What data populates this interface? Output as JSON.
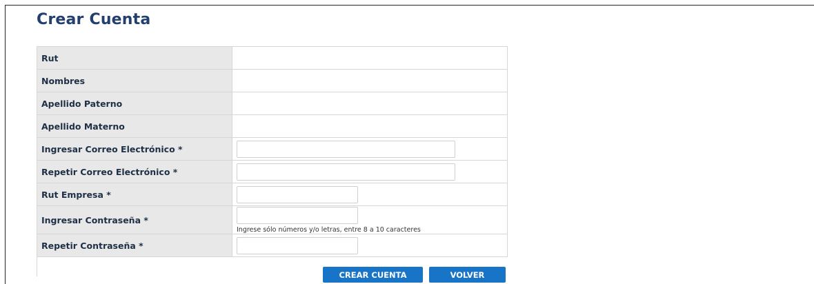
{
  "page": {
    "title": "Crear Cuenta"
  },
  "form": {
    "rows": [
      {
        "label": "Rut",
        "type": "static",
        "value": ""
      },
      {
        "label": "Nombres",
        "type": "static",
        "value": ""
      },
      {
        "label": "Apellido Paterno",
        "type": "static",
        "value": ""
      },
      {
        "label": "Apellido Materno",
        "type": "static",
        "value": ""
      },
      {
        "label": "Ingresar Correo Electrónico *",
        "type": "input",
        "value": ""
      },
      {
        "label": "Repetir Correo Electrónico *",
        "type": "input",
        "value": ""
      },
      {
        "label": "Rut Empresa *",
        "type": "input",
        "value": ""
      },
      {
        "label": "Ingresar Contraseña *",
        "type": "password",
        "value": "",
        "hint": "Ingrese sólo números y/o letras, entre 8 a 10 caracteres"
      },
      {
        "label": "Repetir Contraseña *",
        "type": "password",
        "value": ""
      }
    ]
  },
  "actions": {
    "create_label": "CREAR CUENTA",
    "back_label": "VOLVER",
    "button_color": "#1874c7"
  }
}
